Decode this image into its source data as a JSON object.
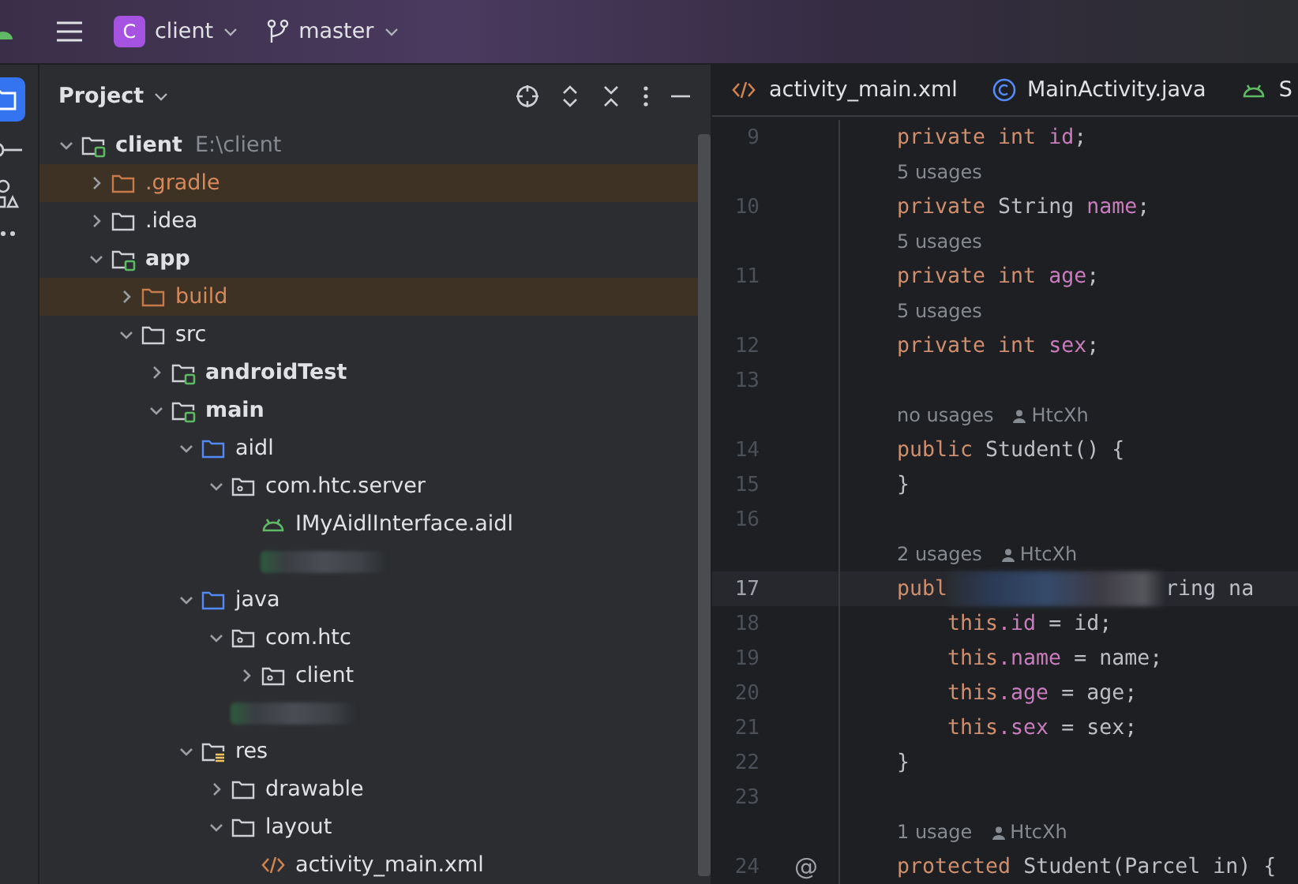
{
  "top_bar": {
    "project": {
      "badge": "C",
      "name": "client"
    },
    "branch": "master"
  },
  "project_panel": {
    "title": "Project",
    "tree": [
      {
        "label": "client",
        "path": "E:\\client",
        "kind": "module",
        "expanded": true,
        "children": [
          {
            "label": ".gradle",
            "kind": "excluded",
            "expanded": false
          },
          {
            "label": ".idea",
            "kind": "plain",
            "expanded": false
          },
          {
            "label": "app",
            "kind": "module",
            "expanded": true,
            "children": [
              {
                "label": "build",
                "kind": "excluded",
                "expanded": false
              },
              {
                "label": "src",
                "kind": "plain",
                "expanded": true,
                "children": [
                  {
                    "label": "androidTest",
                    "kind": "module",
                    "expanded": false
                  },
                  {
                    "label": "main",
                    "kind": "module",
                    "expanded": true,
                    "children": [
                      {
                        "label": "aidl",
                        "kind": "source",
                        "expanded": true,
                        "children": [
                          {
                            "label": "com.htc.server",
                            "kind": "package",
                            "expanded": true,
                            "children": [
                              {
                                "label": "IMyAidlInterface.aidl",
                                "kind": "aidl"
                              },
                              {
                                "kind": "blurred"
                              }
                            ]
                          }
                        ]
                      },
                      {
                        "label": "java",
                        "kind": "source",
                        "expanded": true,
                        "children": [
                          {
                            "label": "com.htc",
                            "kind": "package",
                            "expanded": true,
                            "children": [
                              {
                                "label": "client",
                                "kind": "package",
                                "expanded": false
                              }
                            ]
                          },
                          {
                            "kind": "blurred"
                          }
                        ]
                      },
                      {
                        "label": "res",
                        "kind": "resource",
                        "expanded": true,
                        "children": [
                          {
                            "label": "drawable",
                            "kind": "plain",
                            "expanded": false
                          },
                          {
                            "label": "layout",
                            "kind": "plain",
                            "expanded": true,
                            "children": [
                              {
                                "label": "activity_main.xml",
                                "kind": "xml"
                              }
                            ]
                          }
                        ]
                      }
                    ]
                  }
                ]
              }
            ]
          }
        ]
      }
    ]
  },
  "editor": {
    "tabs": [
      {
        "label": "activity_main.xml",
        "kind": "xml",
        "selected": false
      },
      {
        "label": "MainActivity.java",
        "kind": "class",
        "selected": false
      },
      {
        "label": "S",
        "kind": "android",
        "selected": false
      }
    ],
    "lines": [
      {
        "kind": "code",
        "number": "9",
        "segments": [
          {
            "kind": "keyword",
            "text": "private"
          },
          {
            "kind": "keyword",
            "text": "int"
          },
          {
            "kind": "field",
            "text": "id",
            "after": ";"
          }
        ]
      },
      {
        "kind": "hint",
        "text": "5 usages"
      },
      {
        "kind": "code",
        "number": "10",
        "segments": [
          {
            "kind": "keyword",
            "text": "private"
          },
          {
            "kind": "type",
            "text": "String"
          },
          {
            "kind": "field",
            "text": "name",
            "after": ";"
          }
        ]
      },
      {
        "kind": "hint",
        "text": "5 usages"
      },
      {
        "kind": "code",
        "number": "11",
        "segments": [
          {
            "kind": "keyword",
            "text": "private"
          },
          {
            "kind": "keyword",
            "text": "int"
          },
          {
            "kind": "field",
            "text": "age",
            "after": ";"
          }
        ]
      },
      {
        "kind": "hint",
        "text": "5 usages"
      },
      {
        "kind": "code",
        "number": "12",
        "segments": [
          {
            "kind": "keyword",
            "text": "private"
          },
          {
            "kind": "keyword",
            "text": "int"
          },
          {
            "kind": "field",
            "text": "sex",
            "after": ";"
          }
        ]
      },
      {
        "kind": "code",
        "number": "13"
      },
      {
        "kind": "hint",
        "text": "no usages",
        "author": "HtcXh"
      },
      {
        "kind": "code",
        "number": "14",
        "segments": [
          {
            "kind": "keyword",
            "text": "public"
          },
          {
            "kind": "type",
            "text": "Student() {"
          }
        ]
      },
      {
        "kind": "code",
        "number": "15",
        "segments": [
          {
            "kind": "type",
            "text": "}"
          }
        ]
      },
      {
        "kind": "code",
        "number": "16"
      },
      {
        "kind": "hint",
        "text": "2 usages",
        "author": "HtcXh"
      },
      {
        "kind": "current",
        "number": "17",
        "segments": [
          {
            "kind": "keyword",
            "text": "publ"
          },
          {
            "kind": "blur"
          },
          {
            "kind": "type",
            "text": "ring na"
          }
        ]
      },
      {
        "kind": "nested",
        "number": "18",
        "segments": [
          {
            "kind": "keyword",
            "text": "this"
          },
          {
            "kind": "field",
            "text": ".id",
            "after": " = id;"
          }
        ]
      },
      {
        "kind": "nested",
        "number": "19",
        "segments": [
          {
            "kind": "keyword",
            "text": "this"
          },
          {
            "kind": "field",
            "text": ".name",
            "after": " = name;"
          }
        ]
      },
      {
        "kind": "nested",
        "number": "20",
        "segments": [
          {
            "kind": "keyword",
            "text": "this"
          },
          {
            "kind": "field",
            "text": ".age",
            "after": " = age;"
          }
        ]
      },
      {
        "kind": "nested",
        "number": "21",
        "segments": [
          {
            "kind": "keyword",
            "text": "this"
          },
          {
            "kind": "field",
            "text": ".sex",
            "after": " = sex;"
          }
        ]
      },
      {
        "kind": "code",
        "number": "22",
        "segments": [
          {
            "kind": "type",
            "text": "}"
          }
        ]
      },
      {
        "kind": "code",
        "number": "23"
      },
      {
        "kind": "hint",
        "text": "1 usage",
        "author": "HtcXh"
      },
      {
        "kind": "annotated",
        "number": "24",
        "marker": "@",
        "segments": [
          {
            "kind": "keyword",
            "text": "protected"
          },
          {
            "kind": "type",
            "text": "Student(Parcel in) {"
          }
        ]
      }
    ]
  }
}
